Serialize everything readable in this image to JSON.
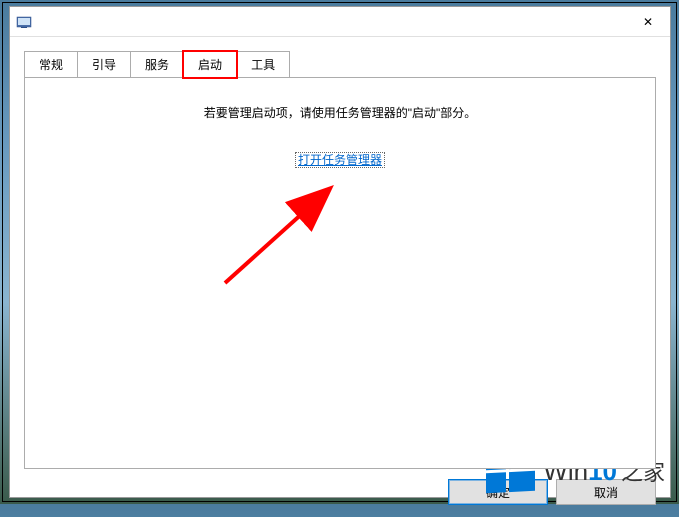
{
  "window": {
    "close_label": "✕"
  },
  "tabs": {
    "items": [
      {
        "label": "常规"
      },
      {
        "label": "引导"
      },
      {
        "label": "服务"
      },
      {
        "label": "启动"
      },
      {
        "label": "工具"
      }
    ],
    "active_index": 3,
    "highlight_index": 3
  },
  "panel": {
    "instruction": "若要管理启动项，请使用任务管理器的\"启动\"部分。",
    "link_label": "打开任务管理器"
  },
  "buttons": {
    "ok": "确定",
    "cancel": "取消"
  },
  "watermark": {
    "t1": "Win",
    "t2": "10",
    "t3": "之家"
  },
  "colors": {
    "accent": "#0078d7",
    "annotation": "#ff0000",
    "link": "#0066cc"
  }
}
